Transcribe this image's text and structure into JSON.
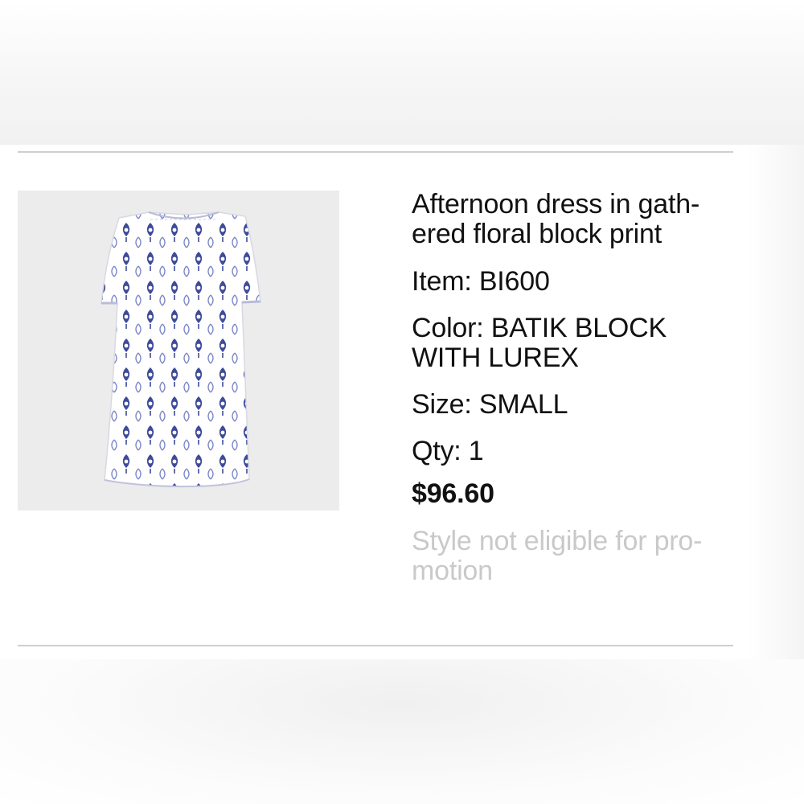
{
  "item": {
    "name": "Afternoon dress in gath-ered floral block print",
    "name_line1": "Afternoon dress in gath-",
    "name_line2": "ered floral block print",
    "item_label": "Item:",
    "item_number": "BI600",
    "color_label": "Color:",
    "color_line1": "BATIK BLOCK",
    "color_line2": "WITH LUREX",
    "size_label": "Size:",
    "size_value": "SMALL",
    "qty_label": "Qty:",
    "qty_value": "1",
    "price": "$96.60",
    "promo_line1": "Style not eligible for pro-",
    "promo_line2": "motion"
  },
  "image": {
    "icon": "product-dress-image",
    "print_color": "#3e4a9a",
    "fabric_color": "#ffffff",
    "background_color": "#ececec"
  },
  "colors": {
    "divider": "#cfcfcf",
    "promo_note": "#c9c9c9",
    "text": "#111111"
  }
}
